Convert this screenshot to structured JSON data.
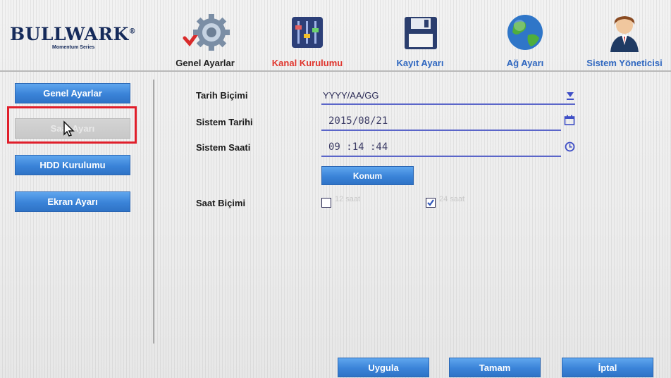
{
  "brand": {
    "name": "BULLWARK",
    "reg": "®",
    "tagline": "Momentum Series"
  },
  "top_tabs": [
    {
      "label": "Genel Ayarlar",
      "icon": "gear-icon",
      "selected": true
    },
    {
      "label": "Kanal Kurulumu",
      "icon": "mixer-sliders-icon"
    },
    {
      "label": "Kayıt Ayarı",
      "icon": "floppy-disk-icon"
    },
    {
      "label": "Ağ Ayarı",
      "icon": "globe-icon"
    },
    {
      "label": "Sistem Yöneticisi",
      "icon": "user-admin-icon"
    }
  ],
  "sidebar": {
    "items": [
      {
        "label": "Genel Ayarlar"
      },
      {
        "label": "Saat Ayarı",
        "disabled": true
      },
      {
        "label": "HDD Kurulumu"
      },
      {
        "label": "Ekran Ayarı"
      }
    ]
  },
  "form": {
    "date_format": {
      "label": "Tarih Biçimi",
      "value": "YYYY/AA/GG"
    },
    "system_date": {
      "label": "Sistem Tarihi",
      "value": "2015/08/21"
    },
    "system_time": {
      "label": "Sistem Saati",
      "value": "09 :14 :44"
    },
    "location_button": "Konum",
    "time_format": {
      "label": "Saat Biçimi",
      "options": [
        {
          "label": "12 saat",
          "checked": false
        },
        {
          "label": "24 saat",
          "checked": true
        }
      ]
    }
  },
  "footer": {
    "apply": "Uygula",
    "ok": "Tamam",
    "cancel": "İptal"
  },
  "colors": {
    "accent_blue": "#3a83d8",
    "tab_red": "#e0352d",
    "tab_blue": "#2f67c0",
    "highlight_red": "#e01f2b"
  }
}
